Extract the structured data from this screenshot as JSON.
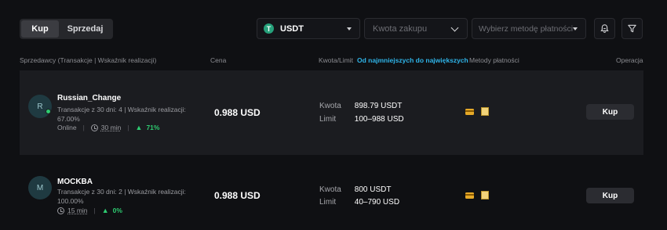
{
  "tabs": {
    "buy_label": "Kup",
    "sell_label": "Sprzedaj"
  },
  "filters": {
    "coin_icon_letter": "T",
    "coin": "USDT",
    "amount_placeholder": "Kwota zakupu",
    "payment_placeholder": "Wybierz metodę płatności"
  },
  "icons": {
    "bell": "bell-icon",
    "filter": "filter-icon"
  },
  "table": {
    "headers": {
      "sellers": "Sprzedawcy (Transakcje | Wskaźnik realizacji)",
      "price": "Cena",
      "amount_limit": "Kwota/Limit",
      "sort": "Od najmniejszych do największych",
      "payment_methods": "Metody płatności",
      "operation": "Operacja"
    },
    "rows": [
      {
        "avatar": "R",
        "name": "Russian_Change",
        "stats_line1": "Transakcje z 30 dni: 4 | Wskaźnik realizacji:",
        "stats_line2": "67.00%",
        "status": "Online",
        "time": "30 min",
        "rating": "71%",
        "price": "0.988 USD",
        "amount_label": "Kwota",
        "amount": "898.79 USDT",
        "limit_label": "Limit",
        "limit": "100–988 USD",
        "action": "Kup"
      },
      {
        "avatar": "M",
        "name": "MOCKBA",
        "stats_line1": "Transakcje z 30 dni: 2 | Wskaźnik realizacji:",
        "stats_line2": "100.00%",
        "time": "15 min",
        "rating": "0%",
        "price": "0.988 USD",
        "amount_label": "Kwota",
        "amount": "800 USDT",
        "limit_label": "Limit",
        "limit": "40–790 USD",
        "action": "Kup"
      }
    ]
  },
  "colors": {
    "background": "#0f1013",
    "row_highlight": "#1b1c20",
    "accent_sort": "#2fb4e8",
    "positive": "#2ecc71",
    "tether": "#26a17b"
  }
}
